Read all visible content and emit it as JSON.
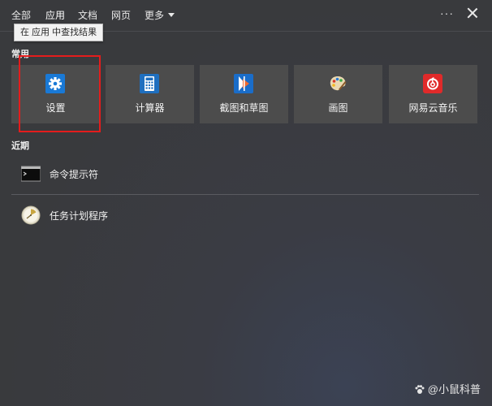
{
  "filters": [
    {
      "label": "全部",
      "active": false
    },
    {
      "label": "应用",
      "active": true
    },
    {
      "label": "文档",
      "active": false
    },
    {
      "label": "网页",
      "active": false
    },
    {
      "label": "更多",
      "active": false
    }
  ],
  "window_controls": {
    "more_options": "···"
  },
  "tooltip": "在 应用 中查找结果",
  "sections": {
    "frequent": "常用",
    "recent": "近期"
  },
  "frequent_apps": [
    {
      "label": "设置",
      "icon": "gear-icon",
      "color": "#1979d6"
    },
    {
      "label": "计算器",
      "icon": "calculator-icon",
      "color": "#1f6fbf"
    },
    {
      "label": "截图和草图",
      "icon": "snip-sketch-icon",
      "color": "#1a6dc9"
    },
    {
      "label": "画图",
      "icon": "paint-palette-icon",
      "color": "#e8d9b0"
    },
    {
      "label": "网易云音乐",
      "icon": "netease-music-icon",
      "color": "#e02a2a"
    }
  ],
  "recent_apps": [
    {
      "label": "命令提示符",
      "icon": "cmd-icon"
    },
    {
      "label": "任务计划程序",
      "icon": "task-scheduler-icon"
    }
  ],
  "watermark": "@小鼠科普",
  "colors": {
    "accent": "#4aa3ff",
    "highlight": "#e41c1c",
    "tile_bg": "#4c4c4c"
  }
}
